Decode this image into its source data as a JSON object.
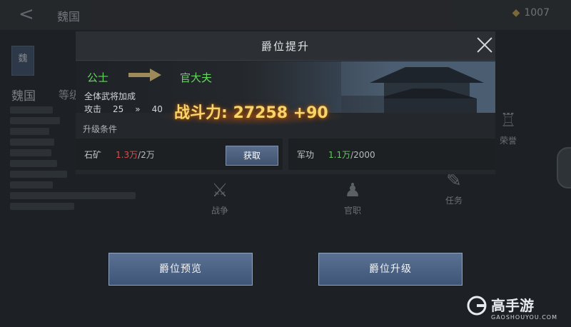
{
  "background": {
    "title": "魏国",
    "currency_value": "1007",
    "currency_icon": "diamond-icon",
    "nation_badge": "魏",
    "nation_name": "魏国",
    "level_label": "等级",
    "icons": [
      {
        "label": "战争",
        "icon": "crossed-swords-icon"
      },
      {
        "label": "官职",
        "icon": "official-icon"
      },
      {
        "label": "任务",
        "icon": "task-icon"
      },
      {
        "label": "荣誉",
        "icon": "honor-icon"
      }
    ]
  },
  "modal": {
    "title": "爵位提升",
    "current_rank": "公士",
    "next_rank": "官大夫",
    "bonus_label": "全体武将加成",
    "stat": {
      "name": "攻击",
      "from": "25",
      "arrow": "»",
      "to": "40"
    },
    "power_text": "战斗力: 27258 +90",
    "conditions_label": "升级条件",
    "resources": [
      {
        "name": "石矿",
        "have": "1.3万",
        "need": "/2万",
        "status": "insufficient"
      },
      {
        "name": "军功",
        "have": "1.1万",
        "need": "/2000",
        "status": "sufficient"
      }
    ],
    "get_button": "获取"
  },
  "buttons": {
    "preview": "爵位预览",
    "upgrade": "爵位升级"
  },
  "watermark": {
    "brand": "高手游",
    "url": "GAOSHOUYOU.COM"
  },
  "colors": {
    "rank_green": "#62d65a",
    "power_gold": "#f4d66d",
    "insufficient_red": "#e14b4b",
    "sufficient_green": "#5fc85a",
    "button_blue": "#4e6486"
  }
}
